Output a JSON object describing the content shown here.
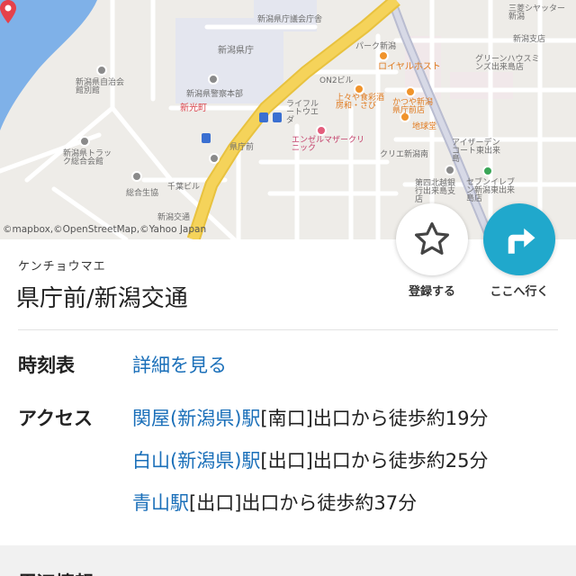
{
  "map": {
    "attribution": "©mapbox,©OpenStreetMap,©Yahoo Japan",
    "labels": {
      "kencho": "新潟県庁",
      "kencho_gikai": "新潟県庁議会庁舎",
      "keisatsu": "新潟県警察本部",
      "shinkocho": "新光町",
      "jichi": "新潟県自治会館別館",
      "truck": "新潟県トラック総合会館",
      "kyosai": "総合生協",
      "kenchomae_stop": "県庁前",
      "kotsu": "新潟交通",
      "seibu": "西新潟",
      "royal": "ロイヤルホスト",
      "kamidoya": "上々や食彩酒房和・さび",
      "katsuya": "かつや新潟県庁前店",
      "chikyudo": "地球堂",
      "angel": "エンゼルマザークリニック",
      "life": "ライフルートウエダ",
      "hokuetsu": "第四北越銀行出来島支店",
      "seven": "セブンイレブン新潟東出来島店",
      "ayase": "アイザーデンコート東出来島",
      "green": "グリーンハウスミンズ出来島店",
      "niigata_shiten": "新潟支店",
      "crea": "クリエ新潟南",
      "mitsubishi": "三菱シヤッター新潟",
      "chiba": "千葉ビル",
      "oni": "ON2ビル",
      "park": "パーク新潟"
    }
  },
  "actions": {
    "register_label": "登録する",
    "go_label": "ここへ行く"
  },
  "station": {
    "kana": "ケンチョウマエ",
    "name": "県庁前/新潟交通"
  },
  "timetable": {
    "label": "時刻表",
    "link": "詳細を見る"
  },
  "access": {
    "label": "アクセス",
    "items": [
      {
        "station": "関屋(新潟県)駅",
        "exit": "[南口]",
        "text": "出口から徒歩約19分"
      },
      {
        "station": "白山(新潟県)駅",
        "exit": "[出口]",
        "text": "出口から徒歩約25分"
      },
      {
        "station": "青山駅",
        "exit": "[出口]",
        "text": "出口から徒歩約37分"
      }
    ]
  },
  "next_section": {
    "heading": "周辺情報"
  },
  "colors": {
    "link": "#1a6fb9",
    "accent": "#20a8cc",
    "map_road_main": "#f5d35a",
    "map_water": "#7fb1e8",
    "pin": "#e5414b"
  },
  "icons": {
    "register": "star-outline-icon",
    "go": "turn-right-arrow-icon",
    "pin": "map-pin-icon"
  }
}
